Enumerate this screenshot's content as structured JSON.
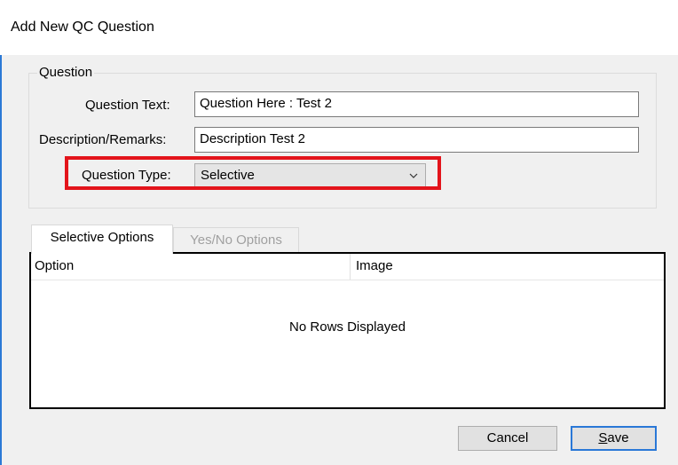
{
  "window": {
    "title": "Add New QC Question"
  },
  "question_group": {
    "legend": "Question",
    "question_text_label": "Question Text:",
    "question_text_value": "Question Here : Test 2",
    "description_label": "Description/Remarks:",
    "description_value": "Description Test 2",
    "question_type_label": "Question Type:",
    "question_type_value": "Selective",
    "highlight_color": "#e3141b"
  },
  "tabs": [
    {
      "label": "Selective Options",
      "active": true
    },
    {
      "label": "Yes/No Options",
      "active": false
    }
  ],
  "grid": {
    "columns": [
      "Option",
      "Image"
    ],
    "empty_text": "No Rows Displayed"
  },
  "buttons": {
    "cancel_label": "Cancel",
    "save_mnemonic": "S",
    "save_rest": "ave",
    "save_border_color": "#2a78d7"
  },
  "icons": {
    "dropdown": "chevron-down-icon"
  }
}
